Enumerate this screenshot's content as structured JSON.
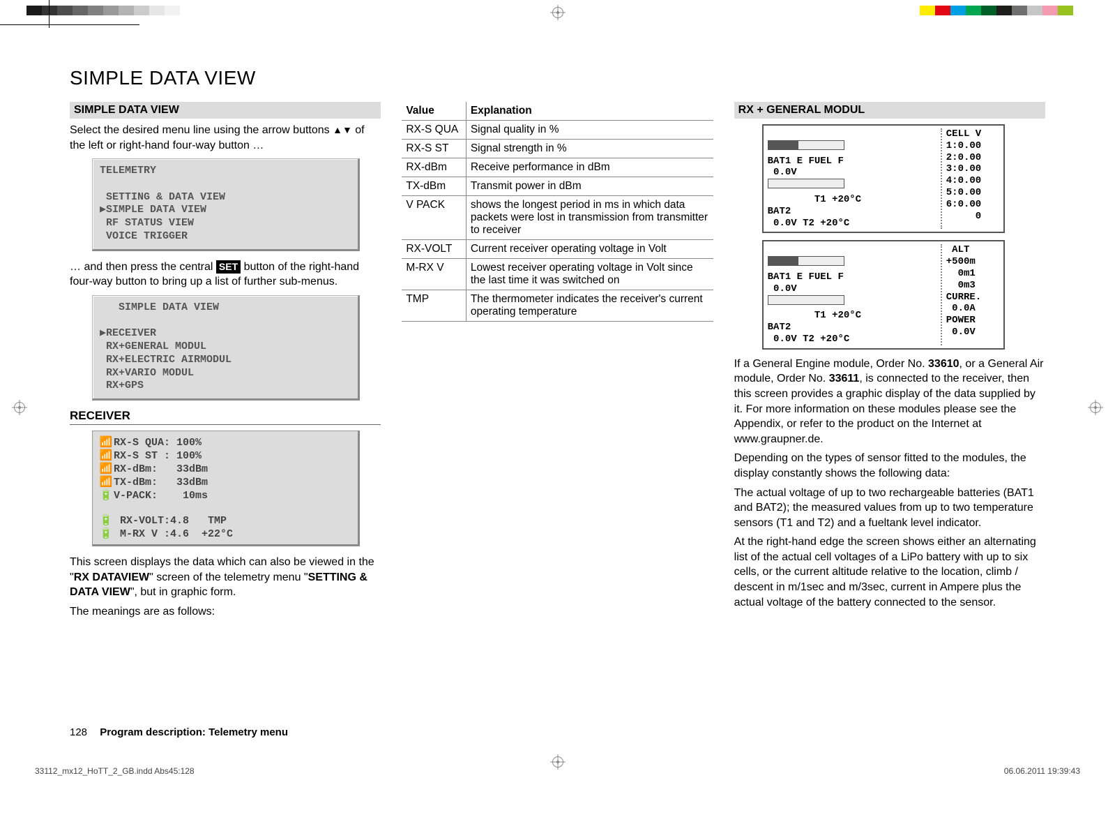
{
  "title": "SIMPLE DATA VIEW",
  "colorbar_left": [
    "#1a1a1a",
    "#333",
    "#4d4d4d",
    "#666",
    "#808080",
    "#999",
    "#b3b3b3",
    "#ccc",
    "#e6e6e6",
    "#f2f2f2",
    "#fff"
  ],
  "colorbar_right": [
    "#ffec00",
    "#e30613",
    "#009fe3",
    "#00a651",
    "#005f27",
    "#1d1d1b",
    "#706f6f",
    "#c6c6c6",
    "#f39ab1",
    "#96c11f",
    "#fff"
  ],
  "col1": {
    "head": "SIMPLE DATA VIEW",
    "intro1_a": "Select the desired menu line using the arrow buttons ",
    "intro1_b": " of the left or right-hand four-way button …",
    "lcd1_l1": "TELEMETRY",
    "lcd1_l2": " SETTING & DATA VIEW",
    "lcd1_l3": "SIMPLE DATA VIEW",
    "lcd1_l4": " RF STATUS VIEW",
    "lcd1_l5": " VOICE TRIGGER",
    "intro2_a": "… and then press the central ",
    "intro2_set": "SET",
    "intro2_b": " button of the right-hand four-way button to bring up a list of further sub-menus.",
    "lcd2_title": "   SIMPLE DATA VIEW",
    "lcd2_l1": "RECEIVER",
    "lcd2_l2": " RX+GENERAL MODUL",
    "lcd2_l3": " RX+ELECTRIC AIRMODUL",
    "lcd2_l4": " RX+VARIO MODUL",
    "lcd2_l5": " RX+GPS",
    "receiver_head": "RECEIVER",
    "rx_l1": "RX-S QUA: 100%",
    "rx_l2": "RX-S ST : 100%",
    "rx_l3": "RX-dBm:   33dBm",
    "rx_l4": "TX-dBm:   33dBm",
    "rx_l5": "V-PACK:    10ms",
    "rx_l6": " RX-VOLT:4.8   TMP",
    "rx_l7": " M-RX V :4.6  +22°C",
    "para1_a": "This screen displays the data which can also be viewed in the \"",
    "para1_b": "RX DATAVIEW",
    "para1_c": "\" screen of the telemetry menu \"",
    "para1_d": "SETTING & DATA VIEW",
    "para1_e": "\", but in graphic form.",
    "para2": "The meanings are as follows:"
  },
  "table": {
    "h1": "Value",
    "h2": "Explanation",
    "rows": [
      {
        "v": "RX-S QUA",
        "e": "Signal quality in %"
      },
      {
        "v": "RX-S ST",
        "e": "Signal strength in %"
      },
      {
        "v": "RX-dBm",
        "e": "Receive performance in dBm"
      },
      {
        "v": "TX-dBm",
        "e": "Transmit power in dBm"
      },
      {
        "v": "V PACK",
        "e": "shows the longest period in ms in which data packets were lost in transmission from transmitter to receiver"
      },
      {
        "v": "RX-VOLT",
        "e": "Current receiver operating voltage in Volt"
      },
      {
        "v": "M-RX V",
        "e": "Lowest receiver operating voltage in Volt since the last time it was switched on"
      },
      {
        "v": "TMP",
        "e": "The thermometer indicates the receiver's current operating temperature"
      }
    ]
  },
  "col3": {
    "head": "RX + GENERAL MODUL",
    "scr1_left_l1": "BAT1 E FUEL F",
    "scr1_left_l2": " 0.0V",
    "scr1_left_l3": "        T1 +20°C",
    "scr1_left_l4": "BAT2",
    "scr1_left_l5": " 0.0V T2 +20°C",
    "scr1_right": "CELL V\n1:0.00\n2:0.00\n3:0.00\n4:0.00\n5:0.00\n6:0.00\n     0",
    "scr2_left_l1": "BAT1 E FUEL F",
    "scr2_left_l2": " 0.0V",
    "scr2_left_l3": "        T1 +20°C",
    "scr2_left_l4": "BAT2",
    "scr2_left_l5": " 0.0V T2 +20°C",
    "scr2_right": " ALT\n+500m\n  0m1\n  0m3\nCURRE.\n 0.0A\nPOWER\n 0.0V",
    "p1_a": "If a General Engine module, Order No. ",
    "p1_b": "33610",
    "p1_c": ", or a General Air module, Order No. ",
    "p1_d": "33611",
    "p1_e": ", is connected to the receiver, then this screen provides a graphic display of the data supplied by it. For more information on these modules please see the Appendix, or refer to the product on the Internet at www.graupner.de.",
    "p2": "Depending on the types of sensor fitted to the modules, the display constantly shows the following data:",
    "p3": "The actual voltage of up to two rechargeable batteries (BAT1 and BAT2); the measured values from up to two temperature sensors (T1 and T2) and a fueltank level indicator.",
    "p4": "At the right-hand edge the screen shows either an alternating list of the actual cell voltages of a LiPo battery with up to six cells, or the current altitude relative to the location, climb / descent in m/1sec and m/3sec, current in Ampere plus the actual voltage of the battery connected to the sensor."
  },
  "footer_num": "128",
  "footer_txt": "Program description: Telemetry menu",
  "indd_left": "33112_mx12_HoTT_2_GB.indd   Abs45:128",
  "indd_right": "06.06.2011   19:39:43"
}
